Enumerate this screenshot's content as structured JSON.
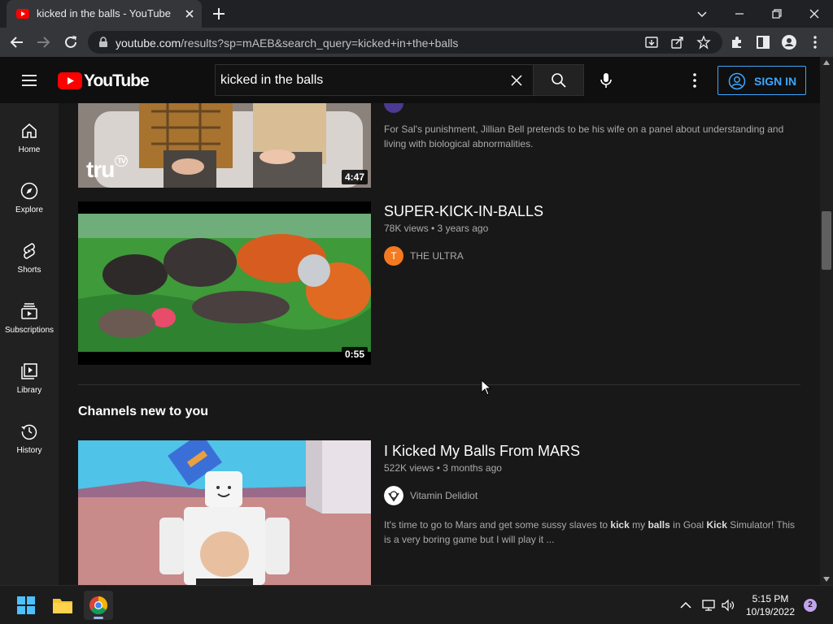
{
  "browser": {
    "tab_title": "kicked in the balls - YouTube",
    "url_host": "youtube.com",
    "url_path": "/results?sp=mAEB&search_query=kicked+in+the+balls"
  },
  "header": {
    "logo_text": "YouTube",
    "search_value": "kicked in the balls",
    "signin_label": "SIGN IN"
  },
  "sidebar": {
    "items": [
      {
        "label": "Home",
        "icon": "home-icon"
      },
      {
        "label": "Explore",
        "icon": "compass-icon"
      },
      {
        "label": "Shorts",
        "icon": "shorts-icon"
      },
      {
        "label": "Subscriptions",
        "icon": "subscriptions-icon"
      },
      {
        "label": "Library",
        "icon": "library-icon"
      },
      {
        "label": "History",
        "icon": "history-icon"
      }
    ]
  },
  "results": {
    "video1": {
      "duration": "4:47",
      "thumb_logo": "tru",
      "thumb_logo_badge": "TV",
      "description": "For Sal's punishment, Jillian Bell pretends to be his wife on a panel about understanding and living with biological abnormalities."
    },
    "video2": {
      "title": "SUPER-KICK-IN-BALLS",
      "meta": "78K views • 3 years ago",
      "channel": "THE ULTRA",
      "channel_initial": "T",
      "duration": "0:55"
    },
    "section_title": "Channels new to you",
    "video3": {
      "title": "I Kicked My Balls From MARS",
      "meta": "522K views • 3 months ago",
      "channel": "Vitamin Delidiot",
      "desc_parts": [
        "It's time to go to Mars and get some sussy slaves to ",
        "kick",
        " my ",
        "balls",
        " in Goal ",
        "Kick",
        " Simulator! This is a very boring game but I will play it ..."
      ]
    }
  },
  "taskbar": {
    "time": "5:15 PM",
    "date": "10/19/2022",
    "notifications": "2"
  },
  "colors": {
    "accent": "#3ea6ff",
    "youtube_red": "#ff0000",
    "channel_orange": "#f4791f"
  }
}
